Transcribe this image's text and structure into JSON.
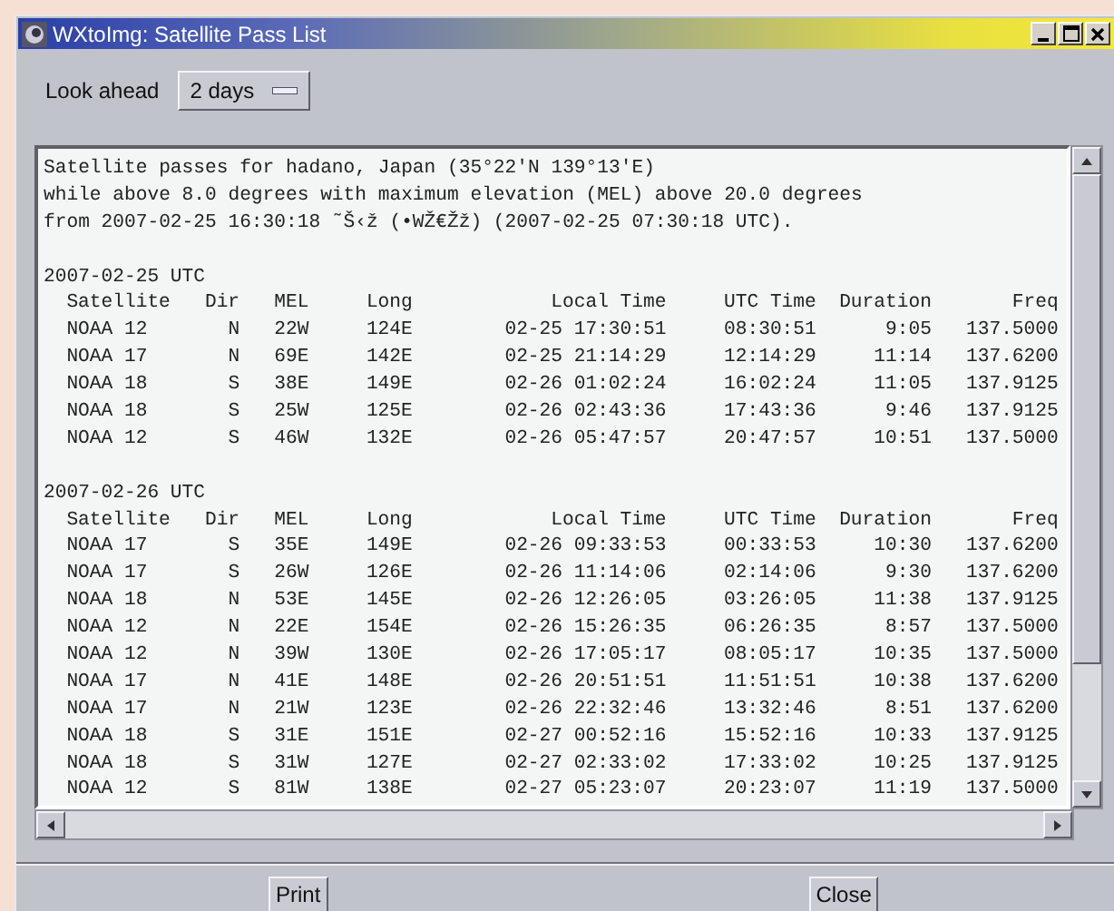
{
  "window": {
    "title": "WXtoImg: Satellite Pass List"
  },
  "look_ahead": {
    "label": "Look ahead",
    "value": "2 days"
  },
  "report": {
    "header": [
      "Satellite passes for hadano, Japan (35°22'N 139°13'E)",
      "while above 8.0 degrees with maximum elevation (MEL) above 20.0 degrees",
      "from 2007-02-25 16:30:18 ˜Š‹ž (•WŽ€Žž) (2007-02-25 07:30:18 UTC)."
    ],
    "days": [
      {
        "date": "2007-02-25 UTC",
        "columns": [
          "Satellite",
          "Dir",
          "MEL",
          "Long",
          "Local Time",
          "UTC Time",
          "Duration",
          "Freq"
        ],
        "rows": [
          [
            "NOAA 12",
            "N",
            "22W",
            "124E",
            "02-25 17:30:51",
            "08:30:51",
            "9:05",
            "137.5000"
          ],
          [
            "NOAA 17",
            "N",
            "69E",
            "142E",
            "02-25 21:14:29",
            "12:14:29",
            "11:14",
            "137.6200"
          ],
          [
            "NOAA 18",
            "S",
            "38E",
            "149E",
            "02-26 01:02:24",
            "16:02:24",
            "11:05",
            "137.9125"
          ],
          [
            "NOAA 18",
            "S",
            "25W",
            "125E",
            "02-26 02:43:36",
            "17:43:36",
            "9:46",
            "137.9125"
          ],
          [
            "NOAA 12",
            "S",
            "46W",
            "132E",
            "02-26 05:47:57",
            "20:47:57",
            "10:51",
            "137.5000"
          ]
        ]
      },
      {
        "date": "2007-02-26 UTC",
        "columns": [
          "Satellite",
          "Dir",
          "MEL",
          "Long",
          "Local Time",
          "UTC Time",
          "Duration",
          "Freq"
        ],
        "rows": [
          [
            "NOAA 17",
            "S",
            "35E",
            "149E",
            "02-26 09:33:53",
            "00:33:53",
            "10:30",
            "137.6200"
          ],
          [
            "NOAA 17",
            "S",
            "26W",
            "126E",
            "02-26 11:14:06",
            "02:14:06",
            "9:30",
            "137.6200"
          ],
          [
            "NOAA 18",
            "N",
            "53E",
            "145E",
            "02-26 12:26:05",
            "03:26:05",
            "11:38",
            "137.9125"
          ],
          [
            "NOAA 12",
            "N",
            "22E",
            "154E",
            "02-26 15:26:35",
            "06:26:35",
            "8:57",
            "137.5000"
          ],
          [
            "NOAA 12",
            "N",
            "39W",
            "130E",
            "02-26 17:05:17",
            "08:05:17",
            "10:35",
            "137.5000"
          ],
          [
            "NOAA 17",
            "N",
            "41E",
            "148E",
            "02-26 20:51:51",
            "11:51:51",
            "10:38",
            "137.6200"
          ],
          [
            "NOAA 17",
            "N",
            "21W",
            "123E",
            "02-26 22:32:46",
            "13:32:46",
            "8:51",
            "137.6200"
          ],
          [
            "NOAA 18",
            "S",
            "31E",
            "151E",
            "02-27 00:52:16",
            "15:52:16",
            "10:33",
            "137.9125"
          ],
          [
            "NOAA 18",
            "S",
            "31W",
            "127E",
            "02-27 02:33:02",
            "17:33:02",
            "10:25",
            "137.9125"
          ],
          [
            "NOAA 12",
            "S",
            "81W",
            "138E",
            "02-27 05:23:07",
            "20:23:07",
            "11:19",
            "137.5000"
          ]
        ]
      }
    ]
  },
  "buttons": [
    "Print",
    "Close"
  ]
}
